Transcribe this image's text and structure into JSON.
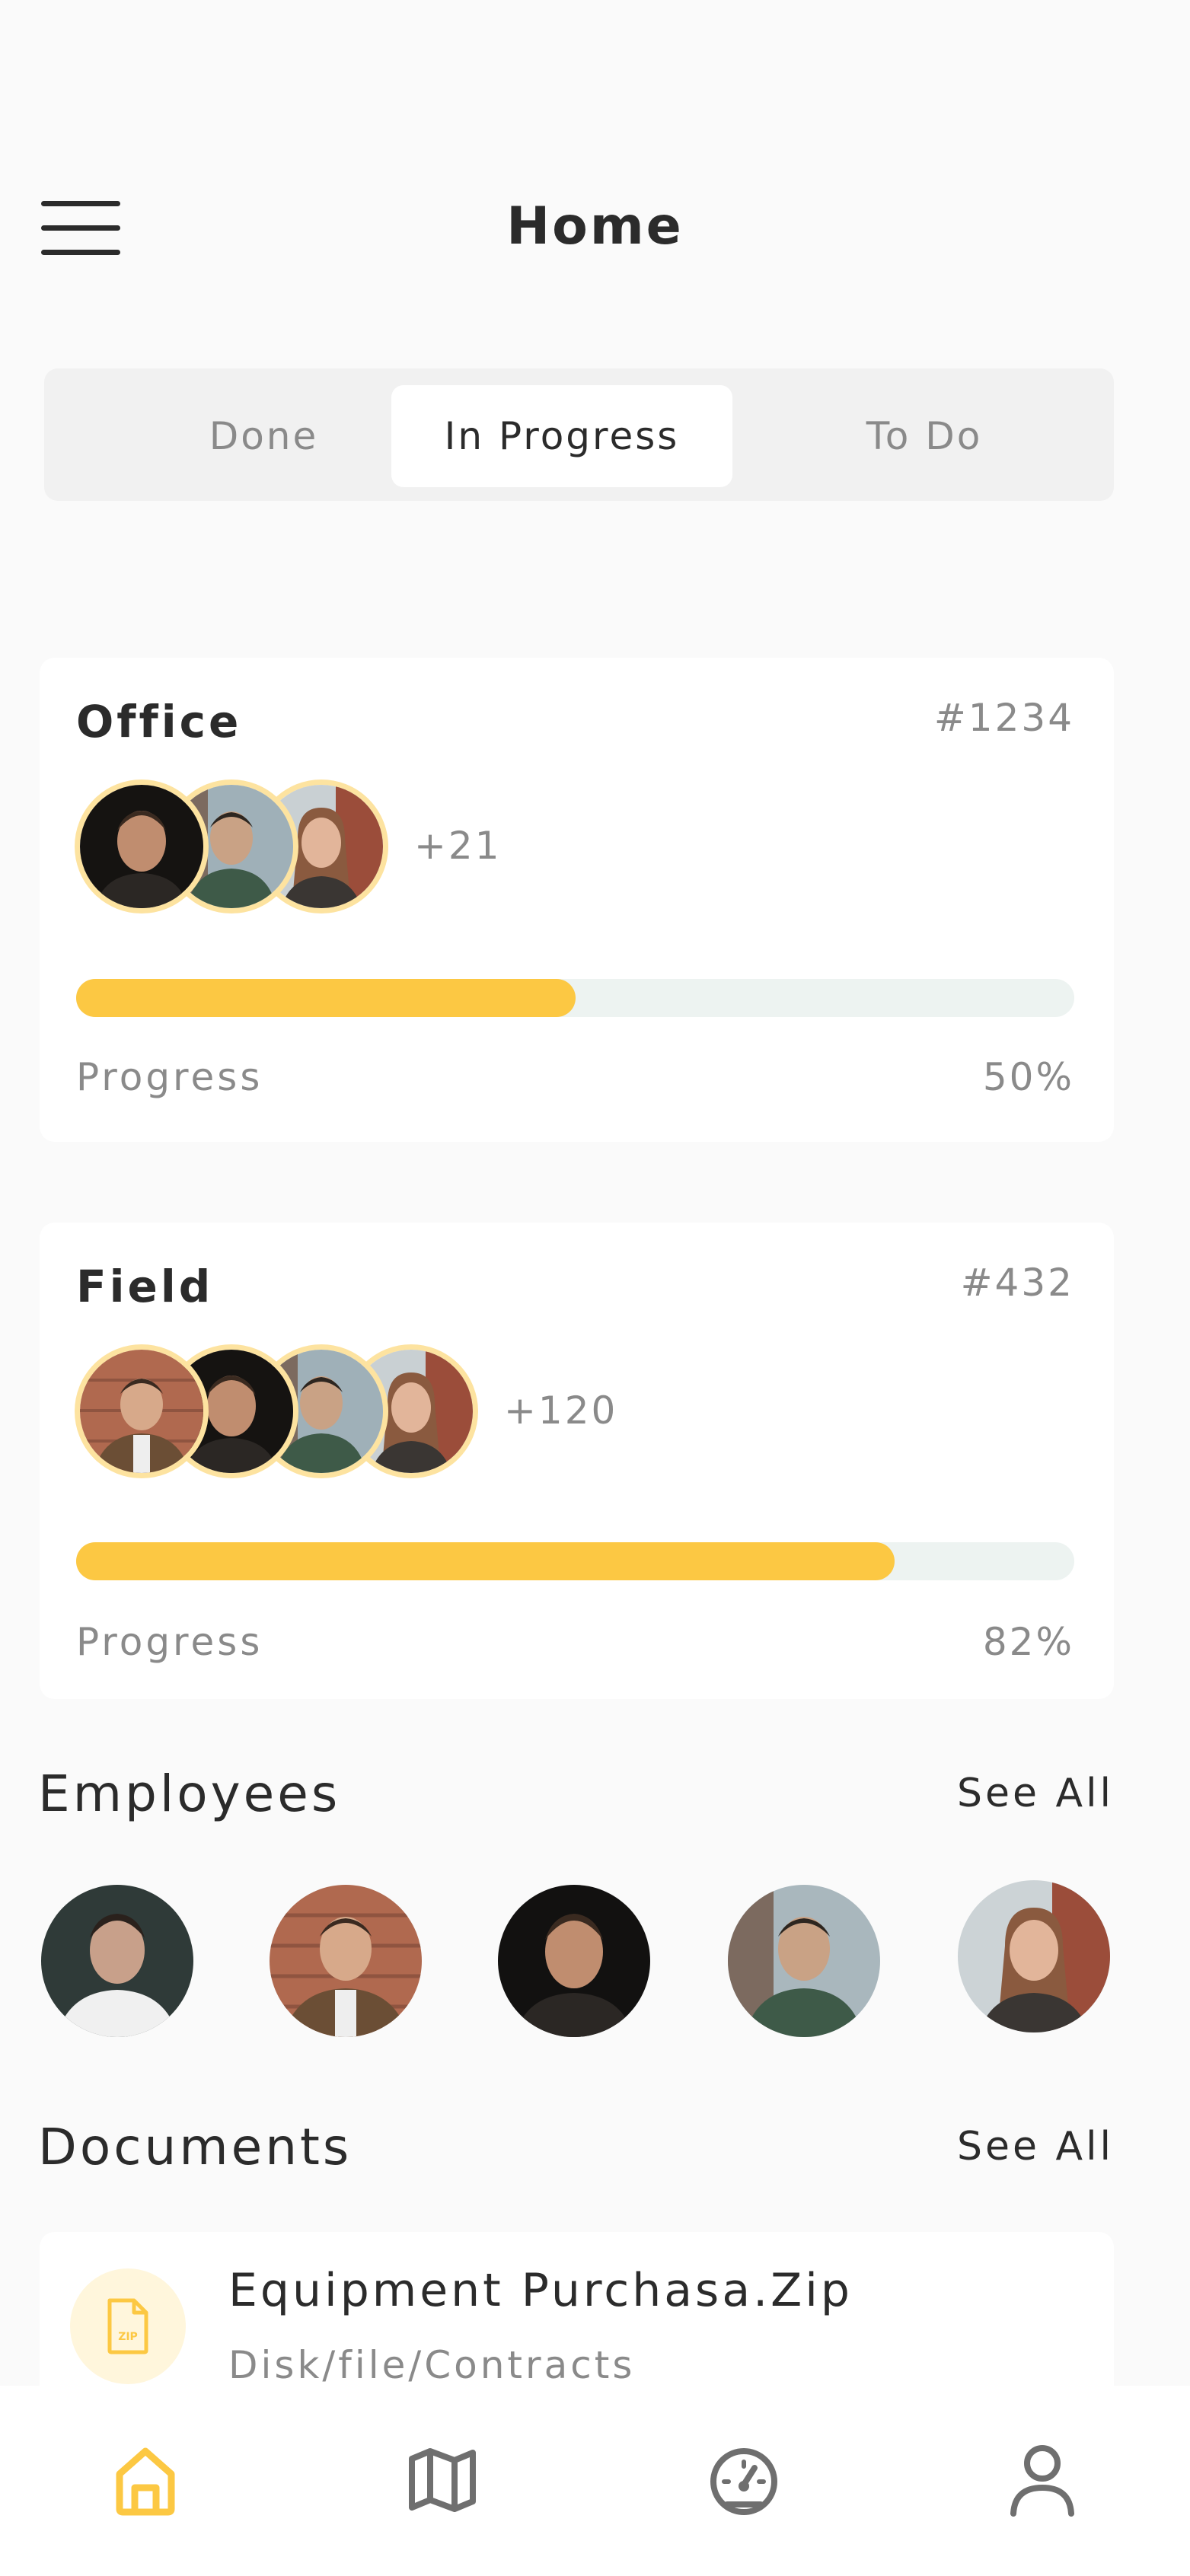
{
  "header": {
    "title": "Home",
    "menu_icon": "hamburger-menu-icon"
  },
  "tabs": [
    {
      "label": "Done",
      "selected": false
    },
    {
      "label": "In Progress",
      "selected": true
    },
    {
      "label": "To Do",
      "selected": false
    }
  ],
  "projects": [
    {
      "title": "Office",
      "id": "#1234",
      "extra_members": "+21",
      "progress_label": "Progress",
      "progress_value": "50%",
      "progress": 0.5
    },
    {
      "title": "Field",
      "id": "#432",
      "extra_members": "+120",
      "progress_label": "Progress",
      "progress_value": "82%",
      "progress": 0.82
    }
  ],
  "employees": {
    "title": "Employees",
    "see_all": "See All"
  },
  "documents": {
    "title": "Documents",
    "see_all": "See All",
    "items": [
      {
        "name": "Equipment Purchasa.Zip",
        "path": "Disk/file/Contracts",
        "badge": "ZIP",
        "icon": "zip-file-icon"
      }
    ]
  },
  "bottom_nav": [
    {
      "icon": "home-icon",
      "active": true
    },
    {
      "icon": "map-icon",
      "active": false
    },
    {
      "icon": "dashboard-gauge-icon",
      "active": false
    },
    {
      "icon": "profile-icon",
      "active": false
    }
  ],
  "colors": {
    "accent": "#fcc843",
    "avatar_ring": "#fde3a0",
    "track": "#edf3f1",
    "muted_text": "#8a8a8a"
  }
}
